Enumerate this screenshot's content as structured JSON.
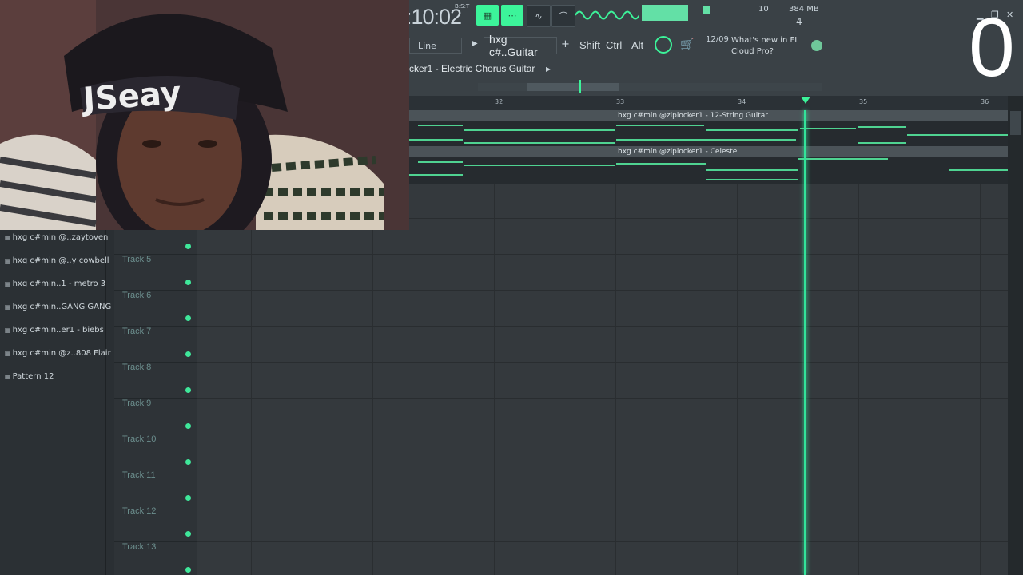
{
  "toolbar": {
    "time": ":10:02",
    "time_unit": "B:S:T",
    "cpu": "10",
    "memory": "384 MB",
    "polyphony": "4",
    "snap_mode": "Line",
    "pattern_selector": "hxg c#..Guitar",
    "add_label": "+",
    "modifier_keys": [
      "Shift",
      "Ctrl",
      "Alt"
    ],
    "news_date": "12/09",
    "news_text": "What's new in FL Cloud Pro?",
    "overlay_digit": "0"
  },
  "playlist": {
    "title": "cker1 - Electric Chorus Guitar",
    "ruler_bars": [
      "32",
      "33",
      "34",
      "35",
      "36"
    ],
    "clips": [
      {
        "label": "hxg c#min @ziplocker1 - 12-String Guitar"
      },
      {
        "label": "hxg c#min @ziplocker1 - Celeste"
      }
    ]
  },
  "patterns": [
    "hxg c#min @..zaytoven",
    "hxg c#min @..y cowbell",
    "hxg c#min..1 - metro 3",
    "hxg c#min..GANG GANG",
    "hxg c#min..er1 - biebs",
    "hxg c#min @z..808 Flair",
    "Pattern 12"
  ],
  "tracks": [
    "Track 5",
    "Track 6",
    "Track 7",
    "Track 8",
    "Track 9",
    "Track 10",
    "Track 11",
    "Track 12",
    "Track 13"
  ],
  "webcam": {
    "cap_text": "JSeay"
  },
  "colors": {
    "accent": "#3cf49a",
    "panel": "#3a4146",
    "grid": "#34393d"
  }
}
